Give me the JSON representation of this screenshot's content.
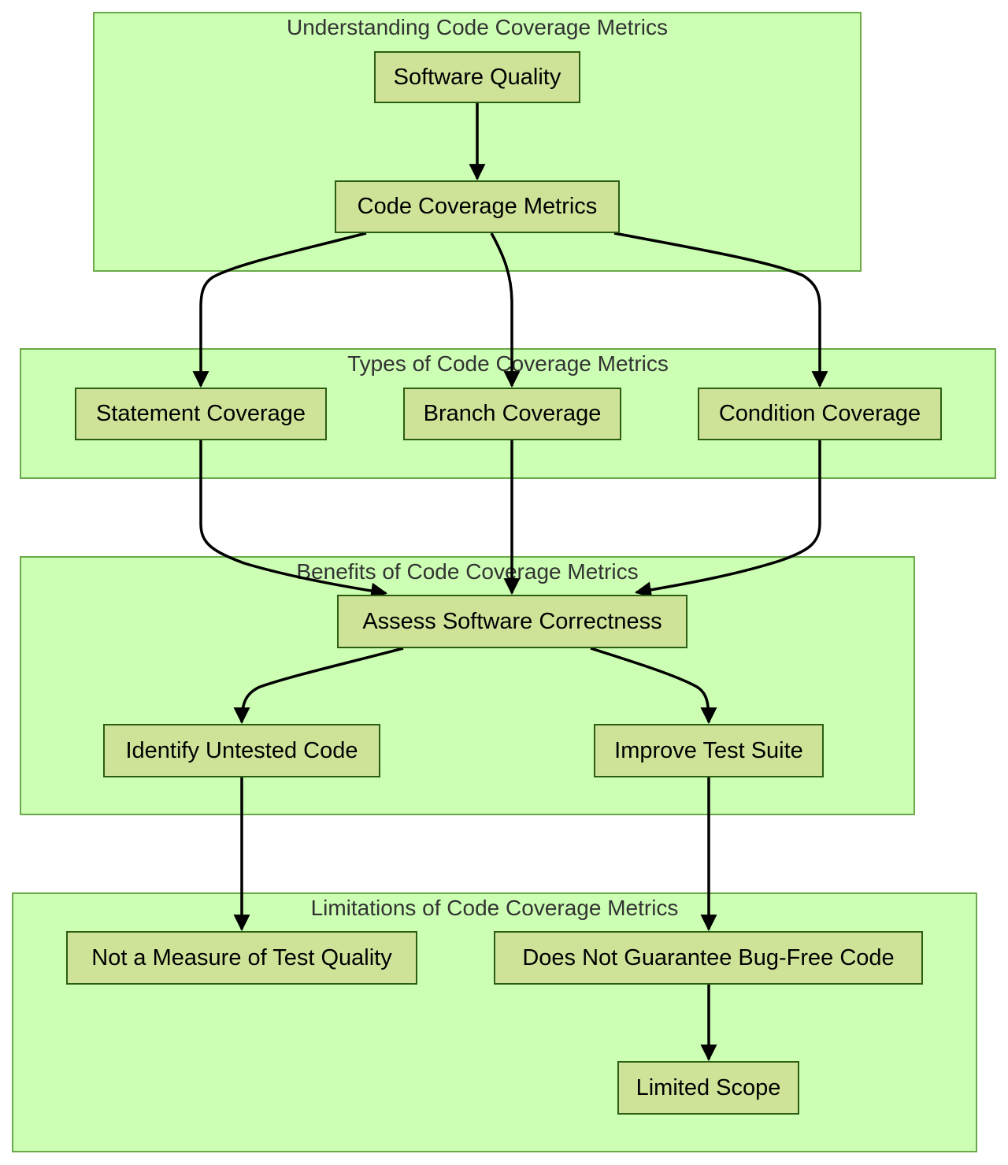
{
  "diagram": {
    "type": "flowchart",
    "clusters": [
      {
        "id": "understanding",
        "title": "Understanding Code Coverage Metrics"
      },
      {
        "id": "types",
        "title": "Types of Code Coverage Metrics"
      },
      {
        "id": "benefits",
        "title": "Benefits of Code Coverage Metrics"
      },
      {
        "id": "limitations",
        "title": "Limitations of Code Coverage Metrics"
      }
    ],
    "nodes": [
      {
        "id": "software_quality",
        "label": "Software Quality",
        "cluster": "understanding"
      },
      {
        "id": "code_coverage_metrics",
        "label": "Code Coverage Metrics",
        "cluster": "understanding"
      },
      {
        "id": "statement_coverage",
        "label": "Statement Coverage",
        "cluster": "types"
      },
      {
        "id": "branch_coverage",
        "label": "Branch Coverage",
        "cluster": "types"
      },
      {
        "id": "condition_coverage",
        "label": "Condition Coverage",
        "cluster": "types"
      },
      {
        "id": "assess_correctness",
        "label": "Assess Software Correctness",
        "cluster": "benefits"
      },
      {
        "id": "identify_untested",
        "label": "Identify Untested Code",
        "cluster": "benefits"
      },
      {
        "id": "improve_suite",
        "label": "Improve Test Suite",
        "cluster": "benefits"
      },
      {
        "id": "not_measure_quality",
        "label": "Not a Measure of Test Quality",
        "cluster": "limitations"
      },
      {
        "id": "not_bug_free",
        "label": "Does Not Guarantee Bug-Free Code",
        "cluster": "limitations"
      },
      {
        "id": "limited_scope",
        "label": "Limited Scope",
        "cluster": "limitations"
      }
    ],
    "edges": [
      {
        "from": "software_quality",
        "to": "code_coverage_metrics"
      },
      {
        "from": "code_coverage_metrics",
        "to": "statement_coverage"
      },
      {
        "from": "code_coverage_metrics",
        "to": "branch_coverage"
      },
      {
        "from": "code_coverage_metrics",
        "to": "condition_coverage"
      },
      {
        "from": "statement_coverage",
        "to": "assess_correctness"
      },
      {
        "from": "branch_coverage",
        "to": "assess_correctness"
      },
      {
        "from": "condition_coverage",
        "to": "assess_correctness"
      },
      {
        "from": "assess_correctness",
        "to": "identify_untested"
      },
      {
        "from": "assess_correctness",
        "to": "improve_suite"
      },
      {
        "from": "identify_untested",
        "to": "not_measure_quality"
      },
      {
        "from": "improve_suite",
        "to": "not_bug_free"
      },
      {
        "from": "not_bug_free",
        "to": "limited_scope"
      }
    ],
    "colors": {
      "cluster_fill": "#ccffb3",
      "cluster_border": "#6aaa4a",
      "node_fill": "#cfe398",
      "node_border": "#2b5e12",
      "edge": "#000000",
      "cluster_title": "#333333"
    }
  }
}
